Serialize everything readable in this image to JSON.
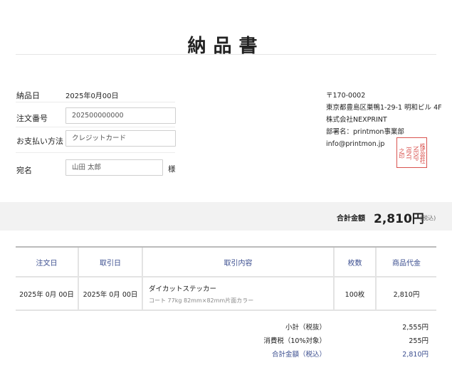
{
  "title": "納品書",
  "form": {
    "delivery_date_label": "納品日",
    "delivery_date_value": "2025年0月00日",
    "order_no_label": "注文番号",
    "order_no_value": "202500000000",
    "payment_label": "お支払い方法",
    "payment_value": "クレジットカード",
    "addressee_label": "宛名",
    "addressee_value": "山田 太郎",
    "honorific": "様"
  },
  "sender": {
    "postal": "〒170-0002",
    "address": "東京都豊島区巣鴨1-29-1 明和ビル 4F",
    "company": "株式会社NEXPRINT",
    "department": "部署名：printmon事業部",
    "email": "info@printmon.jp"
  },
  "seal": {
    "color": "#d9534f",
    "columns": [
      "株式会社",
      "NEXP",
      "RINT",
      "之印"
    ]
  },
  "total": {
    "label": "合計金額",
    "amount": "2,810円",
    "tax_note": "(税込)"
  },
  "table": {
    "headers": [
      "注文日",
      "取引日",
      "取引内容",
      "枚数",
      "商品代金"
    ],
    "rows": [
      {
        "order_date": "2025年 0月 00日",
        "trade_date": "2025年 0月 00日",
        "item": "ダイカットステッカー",
        "item_detail": "コート 77kg 82mm×82mm片面カラー",
        "qty": "100枚",
        "price": "2,810円"
      }
    ]
  },
  "summary": {
    "subtotal_label": "小計（税抜）",
    "subtotal_value": "2,555円",
    "tax_label": "消費税（10%対象）",
    "tax_value": "255円",
    "grand_label": "合計金額（税込）",
    "grand_value": "2,810円"
  },
  "colors": {
    "accent": "#3a4d8f",
    "band": "#f2f2f2"
  }
}
